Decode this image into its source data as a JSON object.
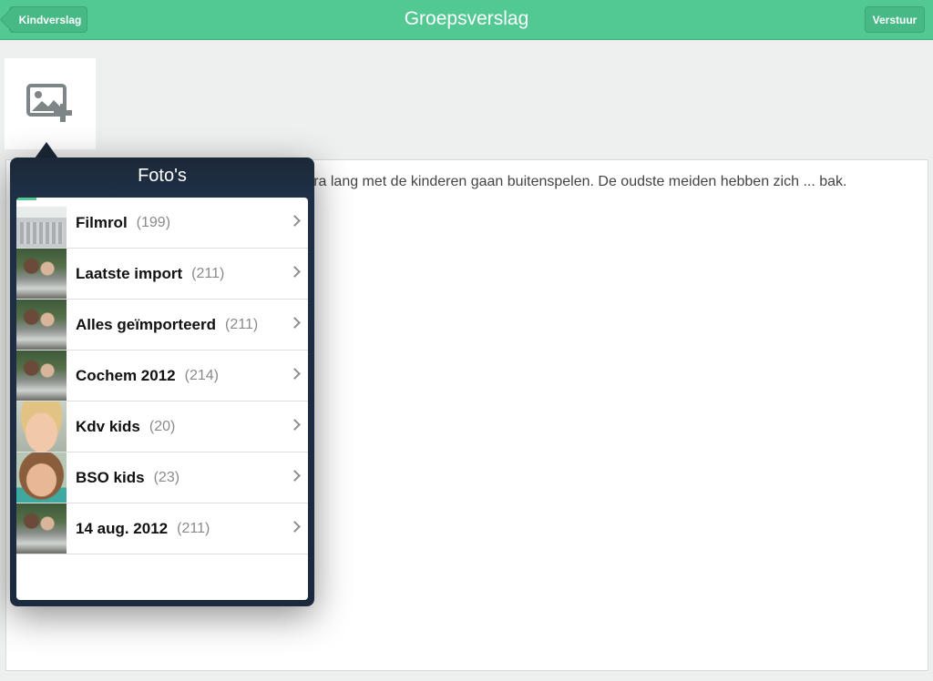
{
  "navbar": {
    "title": "Groepsverslag",
    "back_label": "Kindverslag",
    "send_label": "Verstuur"
  },
  "add_photo": {
    "icon": "add-photo-icon"
  },
  "report_text": "Het was een fijne week. We zijn twee keer extra lang met de kinderen gaan buitenspelen. De oudste meiden hebben zich ... bak.",
  "popover": {
    "title": "Foto's",
    "albums": [
      {
        "name": "Filmrol",
        "count": "(199)",
        "thumb": "screen"
      },
      {
        "name": "Laatste import",
        "count": "(211)",
        "thumb": "family"
      },
      {
        "name": "Alles geïmporteerd",
        "count": "(211)",
        "thumb": "family"
      },
      {
        "name": "Cochem 2012",
        "count": "(214)",
        "thumb": "family"
      },
      {
        "name": "Kdv kids",
        "count": "(20)",
        "thumb": "kid1"
      },
      {
        "name": "BSO kids",
        "count": "(23)",
        "thumb": "kid2"
      },
      {
        "name": "14 aug. 2012",
        "count": "(211)",
        "thumb": "family"
      }
    ]
  }
}
